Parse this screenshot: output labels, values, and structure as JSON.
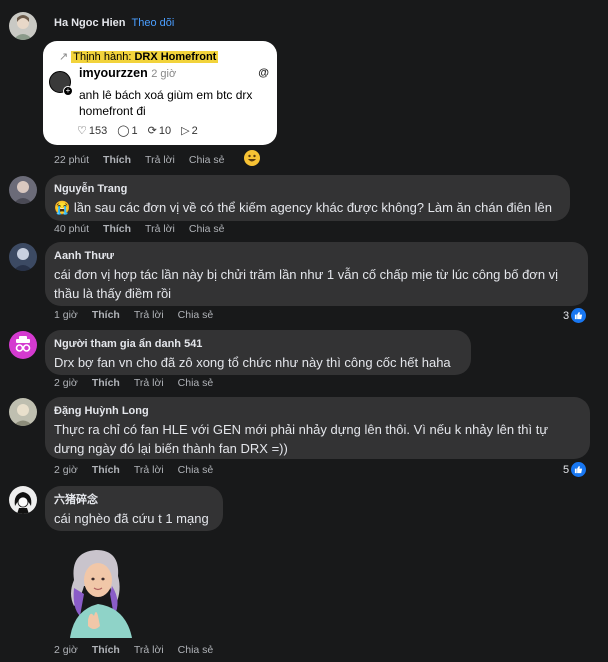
{
  "comments": [
    {
      "name": "Ha Ngoc Hien",
      "follow": "Theo dõi",
      "card": {
        "trend_label": "Thịnh hành:",
        "trend_topic": "DRX Homefront",
        "username": "imyourzzen",
        "time": "2 giờ",
        "text": "anh lê bách xoá giùm em btc drx homefront đi",
        "stats": {
          "likes": "153",
          "replies": "1",
          "reposts": "10",
          "shares": "2"
        }
      },
      "meta": {
        "time": "22 phút",
        "like": "Thích",
        "reply": "Trả lời",
        "share": "Chia sẻ"
      },
      "reaction_emoji": "grinning-face"
    },
    {
      "name": "Nguyễn Trang",
      "text": "lần sau các đơn vị về có thể kiếm agency khác được không? Làm ăn chán điên lên",
      "meta": {
        "time": "40 phút",
        "like": "Thích",
        "reply": "Trả lời",
        "share": "Chia sẻ"
      }
    },
    {
      "name": "Aanh Thưư",
      "lines": [
        "cái đơn vị hợp tác lần này bị chửi trăm lần như 1 vẫn cố chấp mịe từ lúc công bố đơn vị",
        "thầu là thấy điềm rồi"
      ],
      "meta": {
        "time": "1 giờ",
        "like": "Thích",
        "reply": "Trả lời",
        "share": "Chia sẻ"
      },
      "reactions": "3"
    },
    {
      "name": "Người tham gia ẩn danh 541",
      "text": "Drx bợ fan vn cho đã zô xong tổ chức như này thì công cốc hết haha",
      "meta": {
        "time": "2 giờ",
        "like": "Thích",
        "reply": "Trả lời",
        "share": "Chia sẻ"
      }
    },
    {
      "name": "Đặng Huỳnh Long",
      "lines": [
        "Thực ra chỉ có fan HLE với GEN mới phải nhảy dựng lên thôi. Vì nếu k nhảy lên thì tự",
        "dưng ngày đó lại biến thành fan DRX =))"
      ],
      "meta": {
        "time": "2 giờ",
        "like": "Thích",
        "reply": "Trả lời",
        "share": "Chia sẻ"
      },
      "reactions": "5"
    },
    {
      "name": "六猪碎念",
      "text": "cái nghèo đã cứu t 1 mạng",
      "meta": {
        "time": "2 giờ",
        "like": "Thích",
        "reply": "Trả lời",
        "share": "Chia sẻ"
      }
    }
  ],
  "colors": {
    "background": "#18191a",
    "bubble": "#333334",
    "link": "#4a9eff",
    "meta": "#b0b3b8",
    "like_blue": "#1877f2"
  }
}
